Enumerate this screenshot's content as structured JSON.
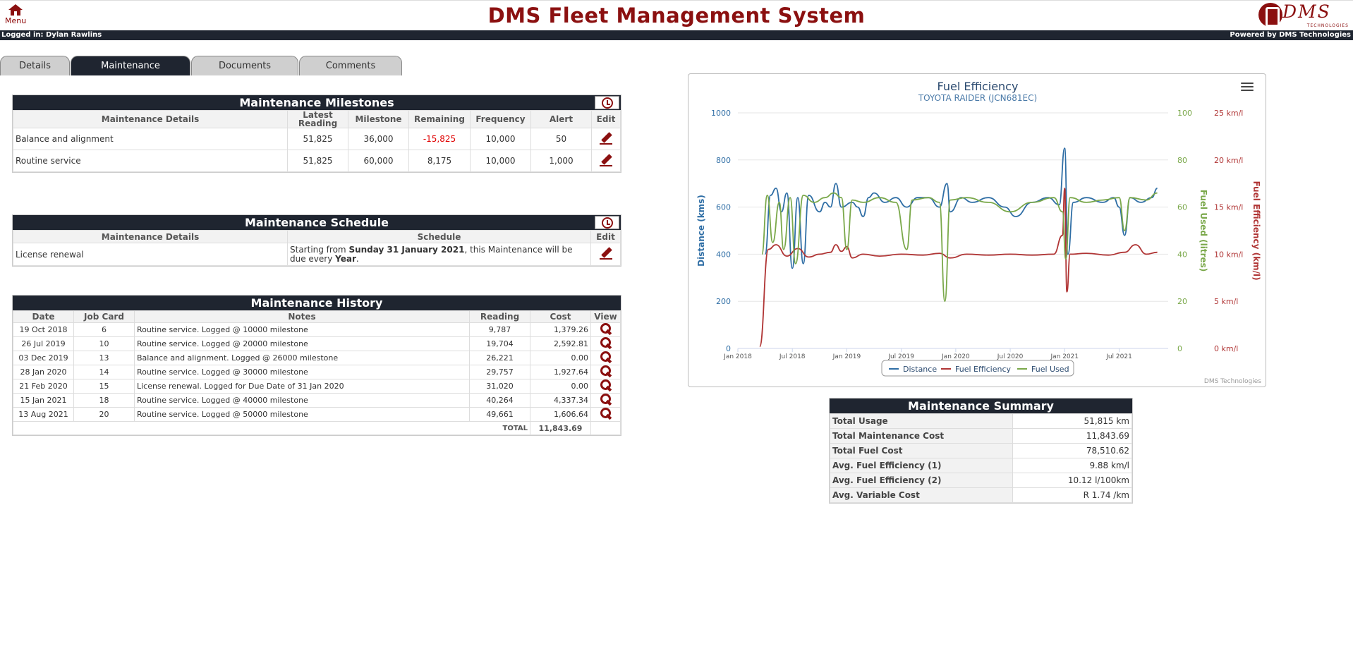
{
  "header": {
    "menu_label": "Menu",
    "title": "DMS Fleet Management System",
    "logo_text": "DMS",
    "logo_sub": "TECHNOLOGIES",
    "logged_in": "Logged in: Dylan Rawlins",
    "powered_by": "Powered by DMS Technologies"
  },
  "tabs": [
    "Details",
    "Maintenance",
    "Documents",
    "Comments"
  ],
  "active_tab": "Maintenance",
  "milestones": {
    "title": "Maintenance Milestones",
    "columns": [
      "Maintenance Details",
      "Latest Reading",
      "Milestone",
      "Remaining",
      "Frequency",
      "Alert",
      "Edit"
    ],
    "rows": [
      {
        "details": "Balance and alignment",
        "latest": "51,825",
        "milestone": "36,000",
        "remaining": "-15,825",
        "frequency": "10,000",
        "alert": "50"
      },
      {
        "details": "Routine service",
        "latest": "51,825",
        "milestone": "60,000",
        "remaining": "8,175",
        "frequency": "10,000",
        "alert": "1,000"
      }
    ]
  },
  "schedule": {
    "title": "Maintenance Schedule",
    "columns": [
      "Maintenance Details",
      "Schedule",
      "Edit"
    ],
    "rows": [
      {
        "details": "License renewal",
        "s_prefix": "Starting from ",
        "s_date": "Sunday 31 January 2021",
        "s_mid": ", this Maintenance will be due every ",
        "s_period": "Year",
        "s_end": "."
      }
    ]
  },
  "history": {
    "title": "Maintenance History",
    "columns": [
      "Date",
      "Job Card",
      "Notes",
      "Reading",
      "Cost",
      "View"
    ],
    "rows": [
      {
        "date": "19 Oct 2018",
        "job": "6",
        "notes": "Routine service. Logged @ 10000 milestone",
        "reading": "9,787",
        "cost": "1,379.26"
      },
      {
        "date": "26 Jul 2019",
        "job": "10",
        "notes": "Routine service. Logged @ 20000 milestone",
        "reading": "19,704",
        "cost": "2,592.81"
      },
      {
        "date": "03 Dec 2019",
        "job": "13",
        "notes": "Balance and alignment. Logged @ 26000 milestone",
        "reading": "26,221",
        "cost": "0.00"
      },
      {
        "date": "28 Jan 2020",
        "job": "14",
        "notes": "Routine service. Logged @ 30000 milestone",
        "reading": "29,757",
        "cost": "1,927.64"
      },
      {
        "date": "21 Feb 2020",
        "job": "15",
        "notes": "License renewal. Logged for Due Date of 31 Jan 2020",
        "reading": "31,020",
        "cost": "0.00"
      },
      {
        "date": "15 Jan 2021",
        "job": "18",
        "notes": "Routine service. Logged @ 40000 milestone",
        "reading": "40,264",
        "cost": "4,337.34"
      },
      {
        "date": "13 Aug 2021",
        "job": "20",
        "notes": "Routine service. Logged @ 50000 milestone",
        "reading": "49,661",
        "cost": "1,606.64"
      }
    ],
    "total_label": "TOTAL",
    "total_value": "11,843.69"
  },
  "summary": {
    "title": "Maintenance Summary",
    "rows": [
      {
        "label": "Total Usage",
        "value": "51,815 km"
      },
      {
        "label": "Total Maintenance Cost",
        "value": "11,843.69"
      },
      {
        "label": "Total Fuel Cost",
        "value": "78,510.62"
      },
      {
        "label": "Avg. Fuel Efficiency (1)",
        "value": "9.88 km/l"
      },
      {
        "label": "Avg. Fuel Efficiency (2)",
        "value": "10.12 l/100km"
      },
      {
        "label": "Avg. Variable Cost",
        "value": "R 1.74 /km"
      }
    ]
  },
  "chart_data": {
    "type": "line",
    "title": "Fuel Efficiency",
    "subtitle": "TOYOTA RAIDER (JCN681EC)",
    "credits": "DMS Technologies",
    "x_ticks": [
      "Jan 2018",
      "Jul 2018",
      "Jan 2019",
      "Jul 2019",
      "Jan 2020",
      "Jul 2020",
      "Jan 2021",
      "Jul 2021"
    ],
    "x_range": [
      "2018-01",
      "2021-12"
    ],
    "axes": {
      "distance": {
        "label": "Distance (kms)",
        "range": [
          0,
          1000
        ],
        "ticks": [
          "0",
          "200",
          "400",
          "600",
          "800",
          "1000"
        ],
        "color": "#2f6ea5"
      },
      "fuel_used": {
        "label": "Fuel Used (litres)",
        "range": [
          0,
          100
        ],
        "ticks": [
          "0",
          "20",
          "40",
          "60",
          "80",
          "100"
        ],
        "color": "#7aa84a"
      },
      "efficiency": {
        "label": "Fuel Efficiency (km/l)",
        "range": [
          0,
          25
        ],
        "ticks": [
          "0 km/l",
          "5 km/l",
          "10 km/l",
          "15 km/l",
          "20 km/l",
          "25 km/l"
        ],
        "color": "#b03535"
      }
    },
    "legend": {
      "position": "bottom-center"
    },
    "series": [
      {
        "name": "Distance",
        "axis": "distance",
        "color": "#2f6ea5",
        "points": [
          [
            2018.25,
            400
          ],
          [
            2018.3,
            650
          ],
          [
            2018.35,
            680
          ],
          [
            2018.4,
            580
          ],
          [
            2018.45,
            660
          ],
          [
            2018.5,
            340
          ],
          [
            2018.55,
            640
          ],
          [
            2018.6,
            360
          ],
          [
            2018.65,
            650
          ],
          [
            2018.75,
            580
          ],
          [
            2018.8,
            620
          ],
          [
            2018.85,
            600
          ],
          [
            2018.9,
            700
          ],
          [
            2018.95,
            600
          ],
          [
            2019.05,
            620
          ],
          [
            2019.1,
            600
          ],
          [
            2019.15,
            560
          ],
          [
            2019.2,
            640
          ],
          [
            2019.25,
            660
          ],
          [
            2019.35,
            620
          ],
          [
            2019.45,
            640
          ],
          [
            2019.55,
            600
          ],
          [
            2019.65,
            640
          ],
          [
            2019.75,
            640
          ],
          [
            2019.85,
            600
          ],
          [
            2019.92,
            700
          ],
          [
            2019.95,
            580
          ],
          [
            2020.05,
            640
          ],
          [
            2020.15,
            620
          ],
          [
            2020.3,
            640
          ],
          [
            2020.45,
            600
          ],
          [
            2020.55,
            560
          ],
          [
            2020.7,
            620
          ],
          [
            2020.85,
            640
          ],
          [
            2020.95,
            610
          ],
          [
            2021.0,
            850
          ],
          [
            2021.03,
            400
          ],
          [
            2021.08,
            620
          ],
          [
            2021.2,
            640
          ],
          [
            2021.35,
            620
          ],
          [
            2021.45,
            640
          ],
          [
            2021.5,
            600
          ],
          [
            2021.55,
            480
          ],
          [
            2021.6,
            640
          ],
          [
            2021.7,
            620
          ],
          [
            2021.8,
            640
          ],
          [
            2021.85,
            680
          ]
        ]
      },
      {
        "name": "Fuel Efficiency",
        "axis": "efficiency",
        "color": "#b03535",
        "points": [
          [
            2018.2,
            0.2
          ],
          [
            2018.28,
            10.5
          ],
          [
            2018.35,
            11
          ],
          [
            2018.45,
            9.8
          ],
          [
            2018.55,
            10.6
          ],
          [
            2018.65,
            9.7
          ],
          [
            2018.75,
            10
          ],
          [
            2018.85,
            10.2
          ],
          [
            2018.9,
            11
          ],
          [
            2018.95,
            10.3
          ],
          [
            2019.0,
            10.8
          ],
          [
            2019.05,
            9.6
          ],
          [
            2019.15,
            10
          ],
          [
            2019.3,
            9.8
          ],
          [
            2019.5,
            10
          ],
          [
            2019.7,
            9.9
          ],
          [
            2019.85,
            10.1
          ],
          [
            2019.95,
            9.6
          ],
          [
            2020.1,
            10
          ],
          [
            2020.3,
            9.9
          ],
          [
            2020.5,
            10
          ],
          [
            2020.7,
            9.9
          ],
          [
            2020.9,
            10
          ],
          [
            2020.98,
            12
          ],
          [
            2021.0,
            17
          ],
          [
            2021.02,
            6
          ],
          [
            2021.05,
            10
          ],
          [
            2021.2,
            10.1
          ],
          [
            2021.4,
            9.9
          ],
          [
            2021.55,
            10.2
          ],
          [
            2021.65,
            11
          ],
          [
            2021.75,
            10
          ],
          [
            2021.85,
            10.2
          ]
        ]
      },
      {
        "name": "Fuel Used",
        "axis": "fuel_used",
        "color": "#7aa84a",
        "points": [
          [
            2018.22,
            40
          ],
          [
            2018.27,
            65
          ],
          [
            2018.32,
            45
          ],
          [
            2018.38,
            62
          ],
          [
            2018.42,
            42
          ],
          [
            2018.48,
            64
          ],
          [
            2018.53,
            36
          ],
          [
            2018.6,
            65
          ],
          [
            2018.7,
            62
          ],
          [
            2018.8,
            64
          ],
          [
            2018.88,
            66
          ],
          [
            2018.95,
            64
          ],
          [
            2019.0,
            42
          ],
          [
            2019.05,
            63
          ],
          [
            2019.15,
            62
          ],
          [
            2019.3,
            64
          ],
          [
            2019.45,
            62
          ],
          [
            2019.55,
            42
          ],
          [
            2019.6,
            63
          ],
          [
            2019.75,
            64
          ],
          [
            2019.85,
            62
          ],
          [
            2019.9,
            20
          ],
          [
            2019.95,
            63
          ],
          [
            2020.1,
            64
          ],
          [
            2020.3,
            62
          ],
          [
            2020.5,
            58
          ],
          [
            2020.7,
            62
          ],
          [
            2020.9,
            64
          ],
          [
            2020.98,
            58
          ],
          [
            2021.01,
            38
          ],
          [
            2021.05,
            64
          ],
          [
            2021.2,
            62
          ],
          [
            2021.35,
            63
          ],
          [
            2021.5,
            64
          ],
          [
            2021.55,
            50
          ],
          [
            2021.6,
            64
          ],
          [
            2021.75,
            63
          ],
          [
            2021.85,
            66
          ]
        ]
      }
    ]
  }
}
